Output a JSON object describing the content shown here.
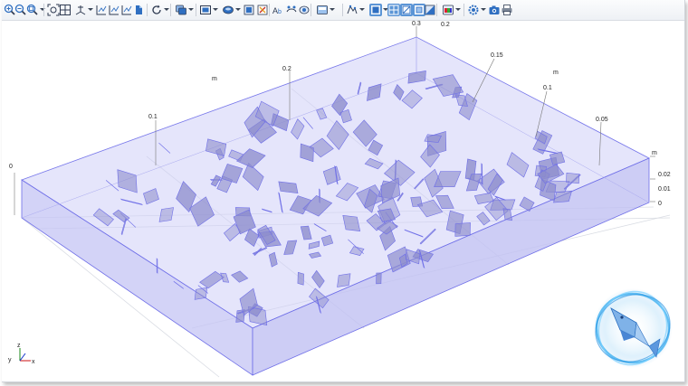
{
  "toolbar": {
    "buttons": [
      {
        "name": "zoom-in-button",
        "icon": "zoom-in-icon"
      },
      {
        "name": "zoom-out-button",
        "icon": "zoom-out-icon"
      },
      {
        "name": "zoom-box-button",
        "icon": "zoom-box-icon",
        "has_menu": true
      },
      {
        "name": "zoom-extents-button",
        "icon": "zoom-extents-icon"
      },
      {
        "name": "fit-window-button",
        "icon": "grid-icon"
      },
      {
        "name": "view-axes-button",
        "icon": "axes-icon",
        "has_menu": true
      },
      {
        "name": "view-xy-button",
        "icon": "plane-xy-icon"
      },
      {
        "name": "view-yz-button",
        "icon": "plane-yz-icon"
      },
      {
        "name": "view-zx-button",
        "icon": "plane-zx-icon"
      },
      {
        "name": "view-3d-button",
        "icon": "view-3d-icon"
      },
      {
        "name": "rotate-button",
        "icon": "rotate-icon",
        "has_menu": true
      },
      {
        "name": "transparency-button",
        "icon": "layers-icon",
        "has_menu": true
      },
      {
        "name": "select-objects-button",
        "icon": "select-box-icon",
        "has_menu": true
      },
      {
        "name": "select-domains-button",
        "icon": "select-domain-icon",
        "has_menu": true
      },
      {
        "name": "select-boundaries-button",
        "icon": "select-boundary-icon"
      },
      {
        "name": "clear-selection-button",
        "icon": "clear-selection-icon"
      },
      {
        "name": "labels-button",
        "icon": "labels-icon"
      },
      {
        "name": "hide-button",
        "icon": "hide-icon"
      },
      {
        "name": "show-button",
        "icon": "show-icon"
      },
      {
        "name": "box-select-button",
        "icon": "box-select-icon",
        "has_menu": true
      },
      {
        "name": "wireframe-button",
        "icon": "wireframe-icon",
        "has_menu": true
      },
      {
        "name": "render-mode-button",
        "icon": "render-mode-icon",
        "active": true,
        "has_menu": true
      },
      {
        "name": "mesh-render-button",
        "icon": "mesh-render-icon",
        "active": true,
        "has_menu": true
      },
      {
        "name": "light-button",
        "icon": "light-icon",
        "active": true
      },
      {
        "name": "scene-light-button",
        "icon": "scene-light-icon",
        "active": true
      },
      {
        "name": "transparency-toggle-button",
        "icon": "transparency-icon"
      },
      {
        "name": "colors-button",
        "icon": "colors-icon",
        "has_menu": true
      },
      {
        "name": "settings-button",
        "icon": "gear-icon",
        "has_menu": true
      },
      {
        "name": "image-snapshot-button",
        "icon": "camera-icon"
      },
      {
        "name": "print-button",
        "icon": "printer-icon"
      }
    ]
  },
  "scene": {
    "domain_color": "#c6c6f4",
    "edge_color": "#6f6fe8",
    "flake_color": "#8c8ccc",
    "flake_count": 150,
    "axis_unit": "m",
    "x_ticks": [
      "0",
      "0.1",
      "0.2",
      "0.3"
    ],
    "y_ticks": [
      "0.2",
      "0.15",
      "0.1",
      "0.05"
    ],
    "z_ticks": [
      "0.02",
      "0.01",
      "0"
    ],
    "triad": {
      "x": "x",
      "y": "y",
      "z": "z"
    }
  }
}
